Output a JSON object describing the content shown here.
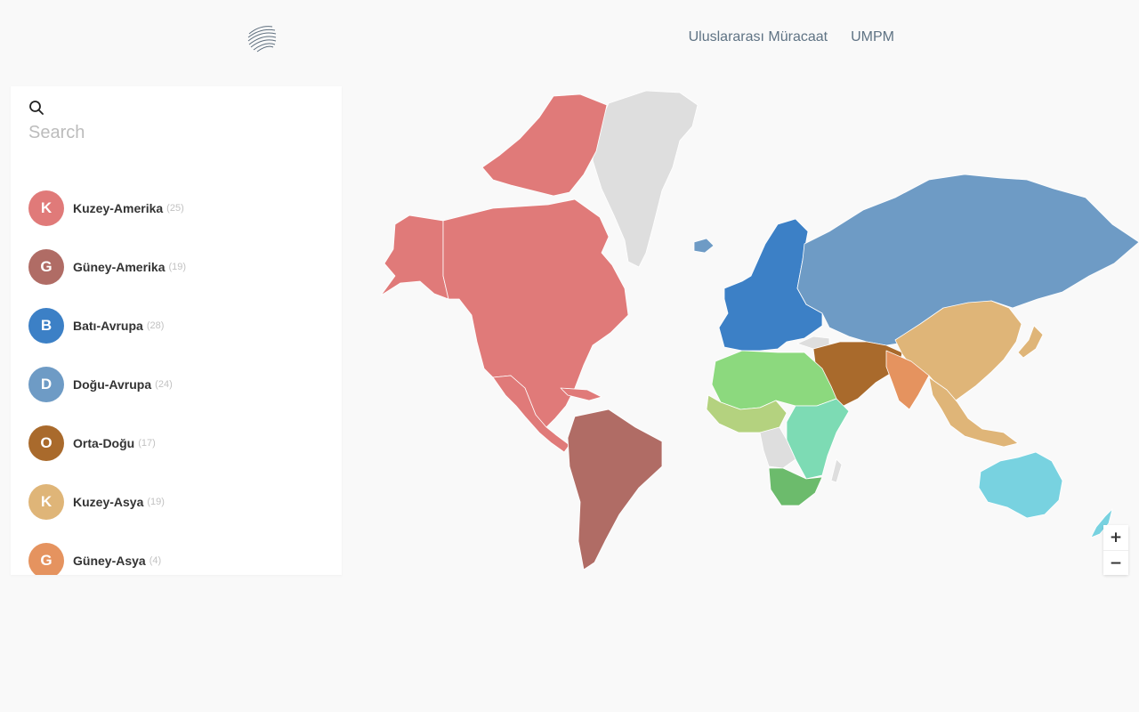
{
  "header": {
    "logo_icon": "globe-logo-icon",
    "nav": [
      {
        "label": "Uluslararası Müracaat"
      },
      {
        "label": "UMPM"
      }
    ]
  },
  "search": {
    "icon": "search-icon",
    "placeholder": "Search",
    "value": ""
  },
  "regions": [
    {
      "letter": "K",
      "name": "Kuzey-Amerika",
      "count": "25",
      "color": "#e07a79"
    },
    {
      "letter": "G",
      "name": "Güney-Amerika",
      "count": "19",
      "color": "#b06c65"
    },
    {
      "letter": "B",
      "name": "Batı-Avrupa",
      "count": "28",
      "color": "#3c80c6"
    },
    {
      "letter": "D",
      "name": "Doğu-Avrupa",
      "count": "24",
      "color": "#6e9bc5"
    },
    {
      "letter": "O",
      "name": "Orta-Doğu",
      "count": "17",
      "color": "#a96a2c"
    },
    {
      "letter": "K",
      "name": "Kuzey-Asya",
      "count": "19",
      "color": "#dfb578"
    },
    {
      "letter": "G",
      "name": "Güney-Asya",
      "count": "4",
      "color": "#e5935f"
    }
  ],
  "map_colors": {
    "north_america": "#e07a79",
    "south_america": "#b06c65",
    "western_europe": "#3c80c6",
    "eastern_europe": "#6e9bc5",
    "middle_east": "#a96a2c",
    "north_asia": "#dfb578",
    "south_asia": "#e5935f",
    "north_africa": "#8cd97e",
    "west_africa": "#b4d27f",
    "east_africa": "#7ddbb4",
    "south_africa": "#6cbb6c",
    "oceania": "#78d2e0",
    "unassigned": "#dedede"
  },
  "zoom": {
    "in_label": "+",
    "out_label": "−"
  }
}
